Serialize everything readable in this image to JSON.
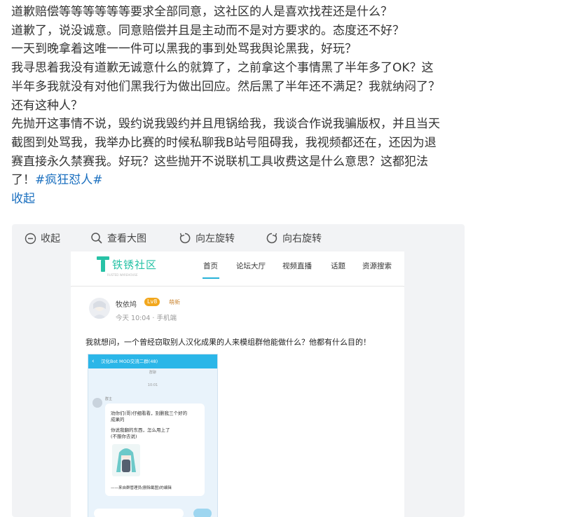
{
  "post": {
    "lines": [
      "道歉赔偿等等等等等等要求全部同意，这社区的人是喜欢找茬还是什么？",
      "道歉了，说没诚意。同意赔偿并且是主动而不是对方要求的。态度还不好？",
      "一天到晚拿着这唯一一件可以黑我的事到处骂我舆论黑我，好玩？",
      "我寻思着我没有道歉无诚意什么的就算了，之前拿这个事情黑了半年多了OK？这",
      "半年多我就没有对他们黑我行为做出回应。然后黑了半年还不满足？我就纳闷了？",
      "还有这种人？",
      "先抛开这事情不说，毁约说我毁约并且甩锅给我，我谈合作说我骗版权，并且当天",
      "截图到处骂我，我举办比赛的时候私聊我B站号阻碍我，我视频都还在，还因为退",
      "赛直接永久禁赛我。好玩？这些抛开不说联机工具收费这是什么意思？这都犯法"
    ],
    "last_line_prefix": "了！",
    "hashtag": "#疯狂怼人#",
    "collapse": "收起"
  },
  "toolbar": {
    "collapse": "收起",
    "view_large": "查看大图",
    "rotate_left": "向左旋转",
    "rotate_right": "向右旋转"
  },
  "screenshot": {
    "logo_text": "铁锈社区",
    "logo_sub": "RUSTED WAREHOUSE",
    "nav": [
      "首页",
      "论坛大厅",
      "视频直播",
      "话题",
      "资源搜索"
    ],
    "username": "牧依鸠",
    "badge": "Lv8",
    "title_tag": "萌新",
    "meta": "今天 10:04 · 手机端",
    "body": "我就想问，一个曾经窃取别人汉化成果的人来模组群他能做什么？他都有什么目的！",
    "chat": {
      "header": "汉化Bot MOD交流二群(48)",
      "subheader": "群聊",
      "time": "10:01",
      "name": "群主",
      "bubble_lines": [
        "劝你们(哥)仔细看看，别删我三个好的",
        "成果的",
        "你说我翻的东西，怎么用上了",
        "(不服你去说)"
      ],
      "signature": "——来自群管理员(删除截图)的编辑"
    }
  },
  "colors": {
    "link": "#1a6fbf",
    "brand": "#27c2a6",
    "badge": "#f2a71d"
  }
}
